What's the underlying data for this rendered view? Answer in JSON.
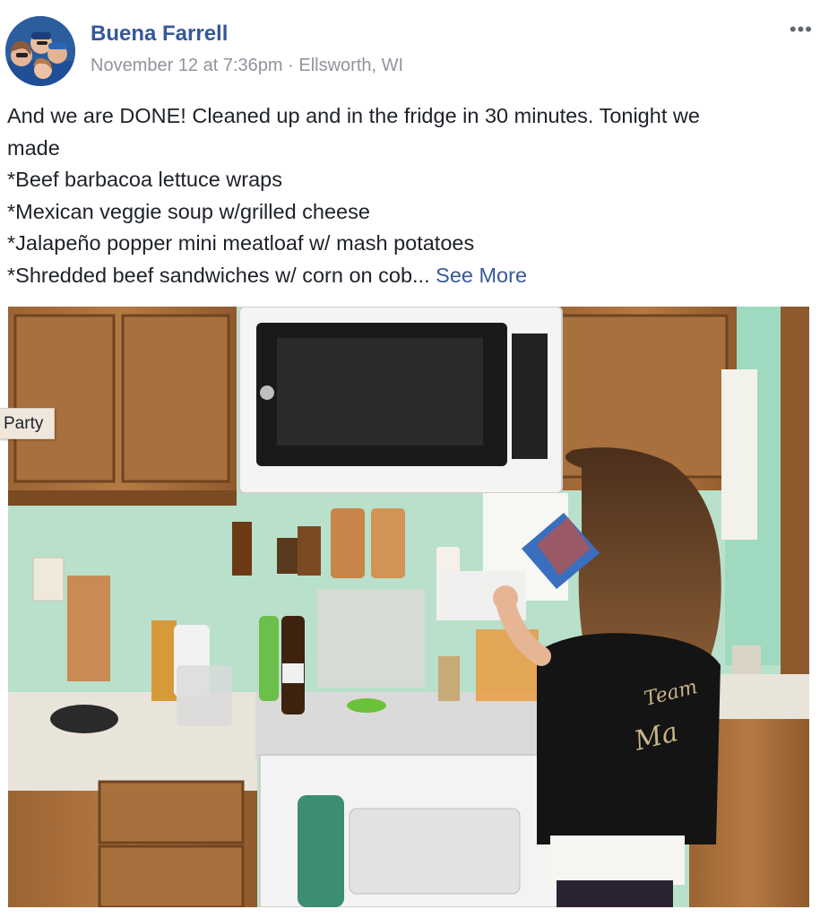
{
  "post": {
    "author": "Buena Farrell",
    "date": "November 12 at 7:36pm",
    "separator": "·",
    "location": "Ellsworth, WI",
    "options_label": "•••",
    "text_lines": [
      "And we are DONE! Cleaned up and in the fridge in 30 minutes. Tonight we",
      "made",
      "*Beef barbacoa lettuce wraps",
      "*Mexican veggie soup w/grilled cheese",
      "*Jalapeño popper mini meatloaf w/ mash potatoes",
      "*Shredded beef sandwiches w/ corn on cob..."
    ],
    "see_more": "See More",
    "photo_tag": "Party",
    "shirt_text": "Team Ma"
  },
  "icons": {
    "avatar": "profile-photo",
    "options": "ellipsis-icon"
  },
  "colors": {
    "link": "#365899",
    "meta": "#90949c",
    "text": "#1d2129"
  }
}
